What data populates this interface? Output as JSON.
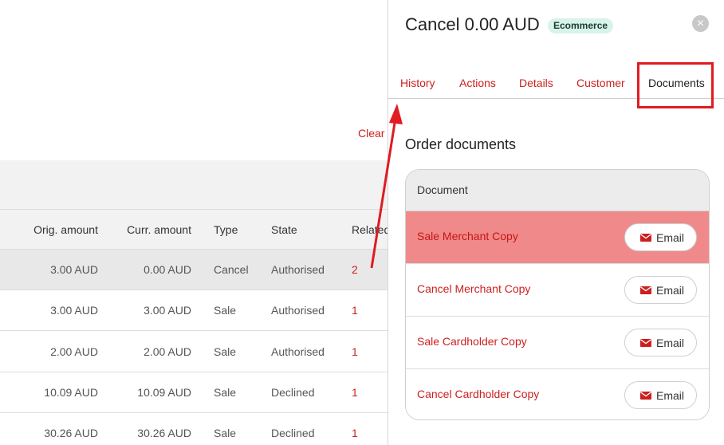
{
  "left": {
    "clear_label": "Clear",
    "table": {
      "headers": [
        "Orig. amount",
        "Curr. amount",
        "Type",
        "State",
        "Related"
      ],
      "rows": [
        {
          "orig": "3.00 AUD",
          "curr": "0.00 AUD",
          "type": "Cancel",
          "state": "Authorised",
          "related": "2",
          "selected": true
        },
        {
          "orig": "3.00 AUD",
          "curr": "3.00 AUD",
          "type": "Sale",
          "state": "Authorised",
          "related": "1"
        },
        {
          "orig": "2.00 AUD",
          "curr": "2.00 AUD",
          "type": "Sale",
          "state": "Authorised",
          "related": "1"
        },
        {
          "orig": "10.09 AUD",
          "curr": "10.09 AUD",
          "type": "Sale",
          "state": "Declined",
          "related": "1"
        },
        {
          "orig": "30.26 AUD",
          "curr": "30.26 AUD",
          "type": "Sale",
          "state": "Declined",
          "related": "1"
        }
      ]
    }
  },
  "drawer": {
    "title": "Cancel 0.00 AUD",
    "badge": "Ecommerce",
    "close_icon": "×",
    "tabs": [
      {
        "label": "History"
      },
      {
        "label": "Actions"
      },
      {
        "label": "Details"
      },
      {
        "label": "Customer"
      },
      {
        "label": "Documents",
        "active": true
      }
    ],
    "section_title": "Order documents",
    "documents": {
      "header": "Document",
      "rows": [
        {
          "name": "Sale Merchant Copy",
          "action": "Email",
          "highlighted": true
        },
        {
          "name": "Cancel Merchant Copy",
          "action": "Email"
        },
        {
          "name": "Sale Cardholder Copy",
          "action": "Email"
        },
        {
          "name": "Cancel Cardholder Copy",
          "action": "Email"
        }
      ]
    }
  },
  "colors": {
    "accent_red": "#cc1f1f",
    "highlight_row": "#f08a8a",
    "badge_bg": "#d8f3ea",
    "annotation_red": "#e01b22"
  }
}
